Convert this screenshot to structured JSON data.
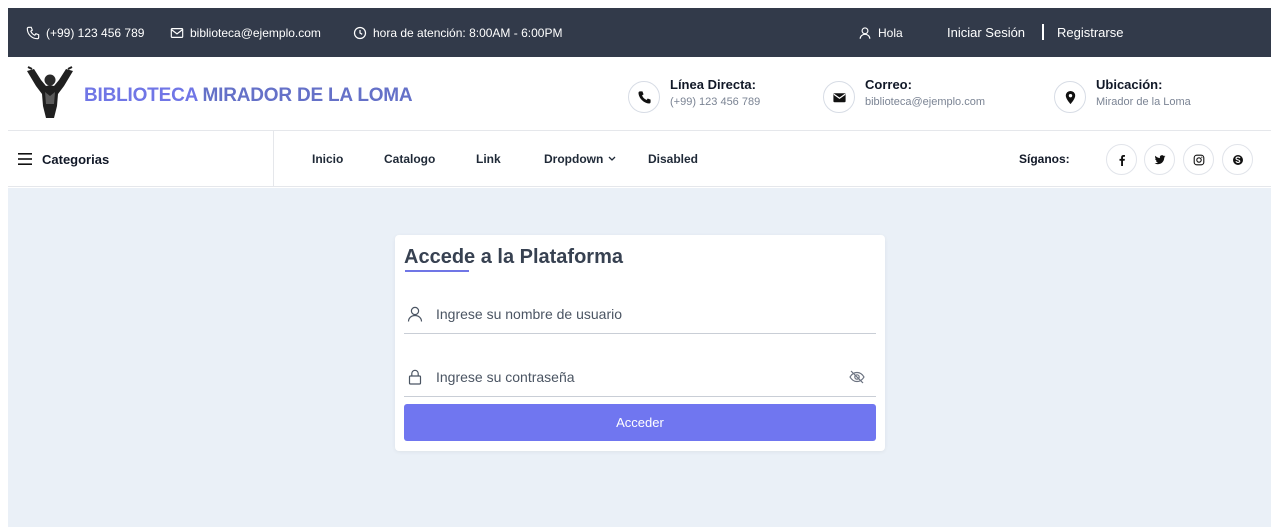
{
  "topbar": {
    "phone": "(+99) 123 456 789",
    "email": "biblioteca@ejemplo.com",
    "hours": "hora de atención: 8:00AM - 6:00PM",
    "greeting": "Hola",
    "login": "Iniciar Sesión",
    "register": "Registrarse"
  },
  "header": {
    "brand_part1": "BIBLIOTECA",
    "brand_part2": "MIRADOR DE LA LOMA",
    "contacts": [
      {
        "label": "Línea Directa:",
        "value": "(+99) 123 456 789",
        "icon": "phone-icon"
      },
      {
        "label": "Correo:",
        "value": "biblioteca@ejemplo.com",
        "icon": "envelope-icon"
      },
      {
        "label": "Ubicación:",
        "value": "Mirador de la Loma",
        "icon": "map-pin-icon"
      }
    ]
  },
  "nav": {
    "categories": "Categorias",
    "links": [
      "Inicio",
      "Catalogo",
      "Link",
      "Dropdown",
      "Disabled"
    ],
    "follow": "Síganos:",
    "socials": [
      "facebook-icon",
      "twitter-icon",
      "instagram-icon",
      "skype-icon"
    ]
  },
  "login": {
    "title": "Accede a la Plataforma",
    "username_placeholder": "Ingrese su nombre de usuario",
    "password_placeholder": "Ingrese su contraseña",
    "submit": "Acceder"
  },
  "colors": {
    "topbar_bg": "#323a4a",
    "accent": "#7076f0",
    "content_bg": "#eaf0f7"
  }
}
